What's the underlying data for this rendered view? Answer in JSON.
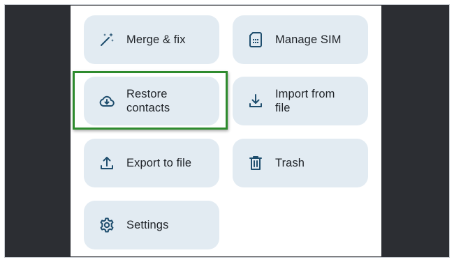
{
  "menu": {
    "merge_fix": {
      "label": "Merge & fix",
      "icon": "magic-wand-icon"
    },
    "manage_sim": {
      "label": "Manage SIM",
      "icon": "sim-card-icon"
    },
    "restore_contacts": {
      "label_line1": "Restore",
      "label_line2": "contacts",
      "icon": "cloud-download-icon"
    },
    "import_from_file": {
      "label_line1": "Import from",
      "label_line2": "file",
      "icon": "download-icon"
    },
    "export_to_file": {
      "label": "Export to file",
      "icon": "upload-icon"
    },
    "trash": {
      "label": "Trash",
      "icon": "trash-icon"
    },
    "settings": {
      "label": "Settings",
      "icon": "gear-icon"
    }
  },
  "colors": {
    "tile_background": "#e2ebf2",
    "icon_color": "#1f4e6e",
    "highlight_border": "#2e8b2e",
    "side_background": "#2c2e33"
  }
}
